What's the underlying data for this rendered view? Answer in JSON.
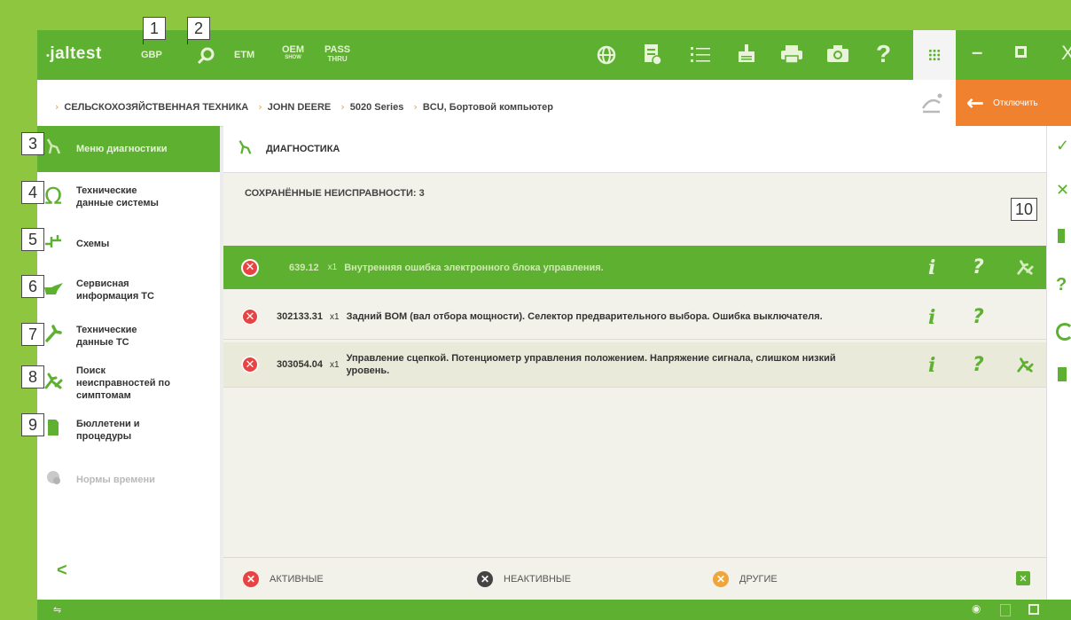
{
  "callouts": [
    "1",
    "2",
    "3",
    "4",
    "5",
    "6",
    "7",
    "8",
    "9",
    "10"
  ],
  "topbar": {
    "logo": "jaltest",
    "gbp": "GBP",
    "etm": "ETM",
    "oem_top": "OEM",
    "oem_bottom": "SHOW",
    "pass_top": "PASS",
    "pass_bottom": "THRU",
    "icons": [
      "globe-icon",
      "document-icon",
      "list-icon",
      "update-icon",
      "printer-icon",
      "camera-icon",
      "help-icon",
      "grid-icon",
      "minimize-icon",
      "maximize-icon",
      "close-icon"
    ],
    "help_glyph": "?",
    "min_glyph": "–",
    "close_glyph": "X"
  },
  "breadcrumb": {
    "items": [
      "СЕЛЬСКОХОЗЯЙСТВЕННАЯ ТЕХНИКА",
      "JOHN DEERE",
      "5020 Series",
      "BCU, Бортовой компьютер"
    ],
    "disconnect_label": "Отключить"
  },
  "sidebar": {
    "items": [
      {
        "label": "Меню диагностики",
        "icon": "diagnostic-menu-icon"
      },
      {
        "label": "Технические\nданные системы",
        "icon": "omega-icon"
      },
      {
        "label": "Схемы",
        "icon": "schematic-icon"
      },
      {
        "label": "Сервисная\nинформация ТС",
        "icon": "oil-can-icon"
      },
      {
        "label": "Технические\nданные ТС",
        "icon": "wrench-icon"
      },
      {
        "label": "Поиск\nнеисправностей по\nсимптомам",
        "icon": "troubleshoot-icon"
      },
      {
        "label": "Бюллетени и\nпроцедуры",
        "icon": "bulletin-icon"
      },
      {
        "label": "Нормы времени",
        "icon": "time-norms-icon"
      }
    ],
    "collapse_glyph": "<"
  },
  "main": {
    "section_title": "ДИАГНОСТИКА",
    "saved_faults_label": "СОХРАНЁННЫЕ НЕИСПРАВНОСТИ: 3",
    "faults": [
      {
        "code": "639.12",
        "count": "x1",
        "description": "Внутренняя ошибка электронного блока управления."
      },
      {
        "code": "302133.31",
        "count": "x1",
        "description": "Задний ВОМ (вал отбора мощности). Селектор предварительного выбора. Ошибка выключателя."
      },
      {
        "code": "303054.04",
        "count": "x1",
        "description": "Управление сцепкой. Потенциометр управления положением. Напряжение сигнала, слишком низкий уровень."
      }
    ],
    "info_glyph": "i",
    "help_glyph": "?",
    "legend": {
      "active": "АКТИВНЫЕ",
      "inactive": "НЕАКТИВНЫЕ",
      "other": "ДРУГИЕ"
    }
  },
  "colors": {
    "brand_green": "#5eb130",
    "accent_orange": "#f0822f",
    "error_red": "#e84343",
    "background_green": "#8ec63f"
  }
}
